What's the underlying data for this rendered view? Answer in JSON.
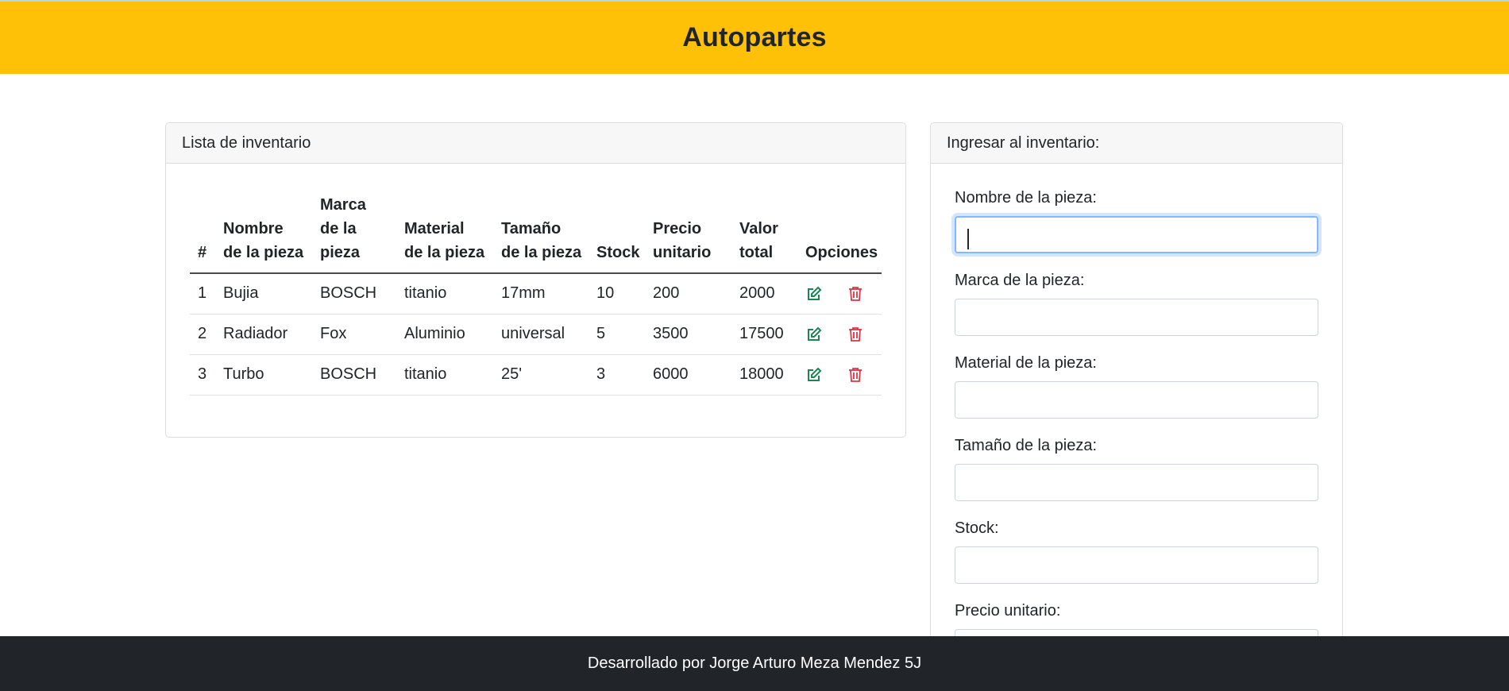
{
  "header": {
    "title": "Autopartes"
  },
  "inventory": {
    "title": "Lista de inventario",
    "columns": [
      {
        "line1": "",
        "line2": "",
        "line3": "#"
      },
      {
        "line1": "",
        "line2": "Nombre",
        "line3": "de la pieza"
      },
      {
        "line1": "Marca",
        "line2": "de la",
        "line3": "pieza"
      },
      {
        "line1": "",
        "line2": "Material",
        "line3": "de la pieza"
      },
      {
        "line1": "",
        "line2": "Tamaño",
        "line3": "de la pieza"
      },
      {
        "line1": "",
        "line2": "",
        "line3": "Stock"
      },
      {
        "line1": "",
        "line2": "Precio",
        "line3": "unitario"
      },
      {
        "line1": "",
        "line2": "Valor",
        "line3": "total"
      },
      {
        "line1": "",
        "line2": "",
        "line3": "Opciones"
      }
    ],
    "rows": [
      {
        "num": "1",
        "nombre": "Bujia",
        "marca": "BOSCH",
        "material": "titanio",
        "tamano": "17mm",
        "stock": "10",
        "precio": "200",
        "total": "2000"
      },
      {
        "num": "2",
        "nombre": "Radiador",
        "marca": "Fox",
        "material": "Aluminio",
        "tamano": "universal",
        "stock": "5",
        "precio": "3500",
        "total": "17500"
      },
      {
        "num": "3",
        "nombre": "Turbo",
        "marca": "BOSCH",
        "material": "titanio",
        "tamano": "25'",
        "stock": "3",
        "precio": "6000",
        "total": "18000"
      }
    ],
    "icons": {
      "edit": "edit-icon",
      "delete": "trash-icon"
    },
    "colors": {
      "edit": "#198754",
      "delete": "#dc3545"
    }
  },
  "form": {
    "title": "Ingresar al inventario:",
    "fields": [
      {
        "label": "Nombre de la pieza:",
        "value": ""
      },
      {
        "label": "Marca de la pieza:",
        "value": ""
      },
      {
        "label": "Material de la pieza:",
        "value": ""
      },
      {
        "label": "Tamaño de la pieza:",
        "value": ""
      },
      {
        "label": "Stock:",
        "value": ""
      },
      {
        "label": "Precio unitario:",
        "value": ""
      }
    ]
  },
  "footer": {
    "text": "Desarrollado por Jorge Arturo Meza Mendez 5J"
  },
  "colors": {
    "header": "#ffc107",
    "footer": "#212529"
  }
}
